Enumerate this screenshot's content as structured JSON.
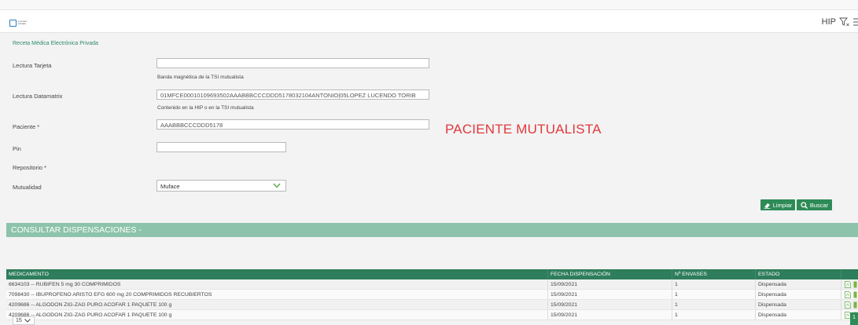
{
  "header": {
    "logo_text": "e-receta privada",
    "hip_label": "HIP",
    "filter_icon": "filter-clear-icon",
    "menu_icon": "menu-icon"
  },
  "section": {
    "title": "Receta Médica Electrónica Privada"
  },
  "form": {
    "lectura_tarjeta": {
      "label": "Lectura Tarjeta",
      "value": "",
      "hint": "Banda magnética de la TSI mutualista"
    },
    "lectura_datamatrix": {
      "label": "Lectura Datamatrix",
      "value": "01MFCE00010109693502AAABBBCCCDDD5178032104ANTONIO|05LOPEZ LUCENDO TORIB",
      "hint": "Contenido en la HIP o en la TSI mutualista"
    },
    "paciente": {
      "label": "Paciente *",
      "value": "AAABBBCCCDDD5178"
    },
    "pin": {
      "label": "Pin",
      "value": ""
    },
    "repositorio": {
      "label": "Repositorio *"
    },
    "mutualidad": {
      "label": "Mutualidad",
      "selected": "Muface"
    }
  },
  "note": "PACIENTE MUTUALISTA",
  "buttons": {
    "limpiar": "Limpiar",
    "buscar": "Buscar"
  },
  "consult_title": "CONSULTAR DISPENSACIONES -",
  "table": {
    "headers": [
      "MEDICAMENTO",
      "FECHA DISPENSACIÓN",
      "Nº ENVASES",
      "ESTADO"
    ],
    "rows": [
      [
        "6634103 -- RUBIFEN 5 mg 30 COMPRIMIDOS",
        "15/09/2021",
        "1",
        "Dispensada"
      ],
      [
        "7098430 -- IBUPROFENO ARISTO EFG 600 mg 20 COMPRIMIDOS RECUBIERTOS",
        "15/09/2021",
        "1",
        "Dispensada"
      ],
      [
        "4209686 -- ALGODON ZIG-ZAG PURO ACOFAR 1 PAQUETE 100 g",
        "15/09/2021",
        "1",
        "Dispensada"
      ],
      [
        "4209686 -- ALGODON ZIG-ZAG PURO ACOFAR 1 PAQUETE 100 g",
        "15/09/2021",
        "1",
        "Dispensada"
      ]
    ]
  },
  "pagination": {
    "page_size": "15",
    "current_page": "1"
  },
  "colors": {
    "accent_green": "#2e8b57",
    "header_bar": "#8dc3ab",
    "alert_red": "#e0393c"
  }
}
